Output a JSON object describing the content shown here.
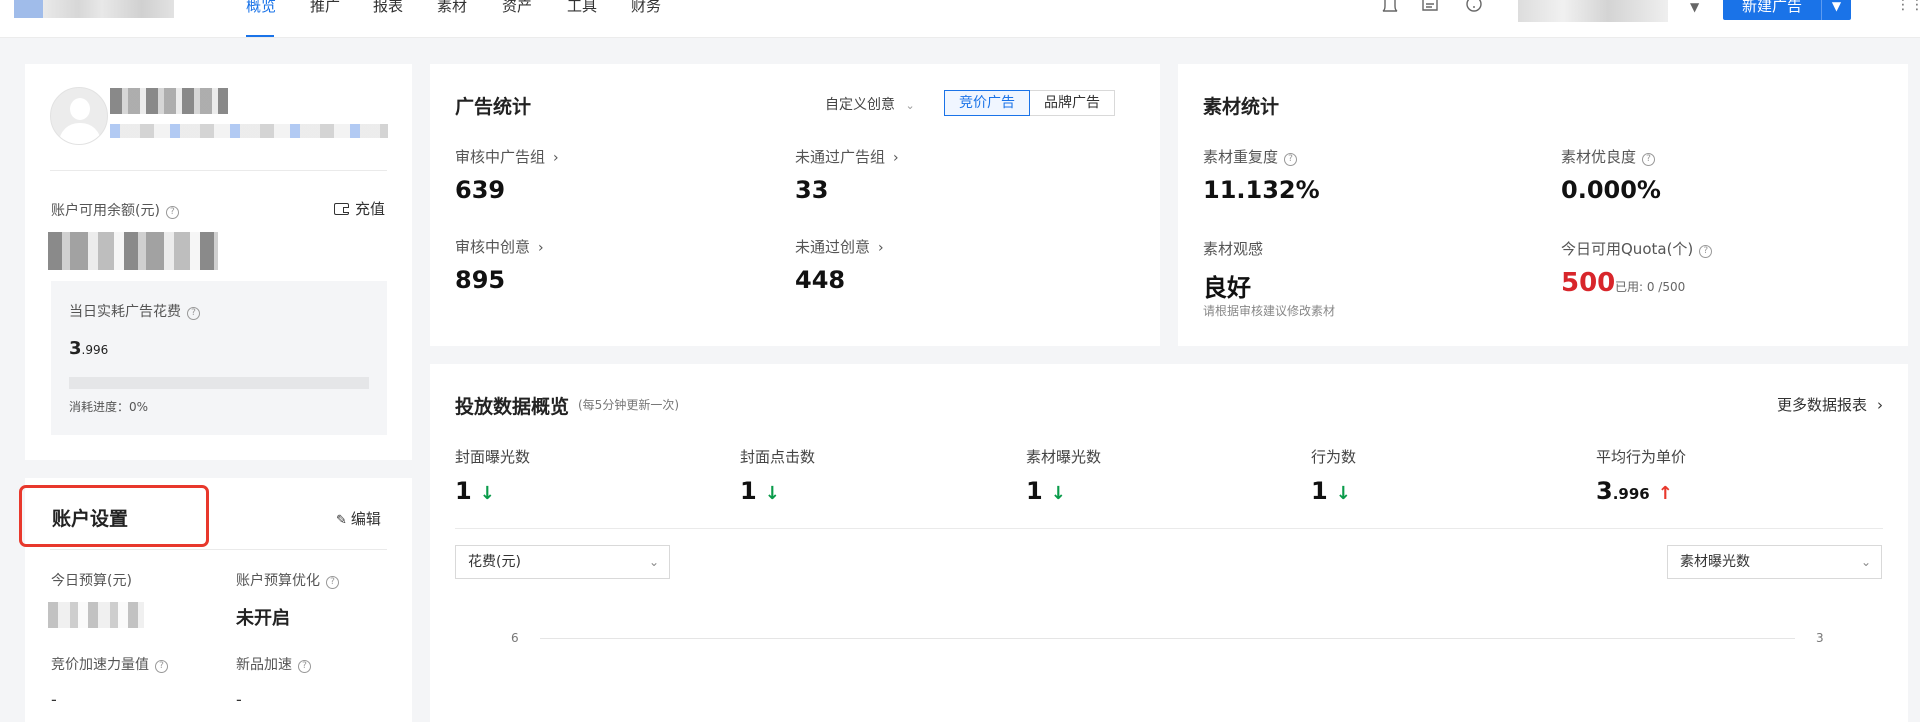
{
  "nav": {
    "items": [
      "概览",
      "推广",
      "报表",
      "素材",
      "资产",
      "工具",
      "财务"
    ],
    "active": "概览",
    "new_button": "新建广告"
  },
  "icons": [
    "bell-icon",
    "message-icon",
    "help-icon",
    "apps-grid-icon"
  ],
  "profile": {
    "balance_label": "账户可用余额(元)",
    "recharge": "充值",
    "daily_spend_label": "当日实耗广告花费",
    "daily_spend_int": "3",
    "daily_spend_dec": ".996",
    "progress_text": "消耗进度：0%",
    "progress_fraction": 0
  },
  "settings": {
    "title": "账户设置",
    "edit": "编辑",
    "today_budget_label": "今日预算(元)",
    "budget_opt_label": "账户预算优化",
    "budget_opt_value": "未开启",
    "bid_boost_label": "竞价加速力量值",
    "bid_boost_value": "-",
    "new_product_label": "新品加速",
    "new_product_value": "-"
  },
  "ad_stats": {
    "title": "广告统计",
    "dropdown": "自定义创意",
    "tabs": [
      "竞价广告",
      "品牌广告"
    ],
    "active_tab": "竞价广告",
    "items": [
      {
        "label": "审核中广告组",
        "value": "639"
      },
      {
        "label": "未通过广告组",
        "value": "33"
      },
      {
        "label": "审核中创意",
        "value": "895"
      },
      {
        "label": "未通过创意",
        "value": "448"
      }
    ]
  },
  "material_stats": {
    "title": "素材统计",
    "repeat_label": "素材重复度",
    "repeat_value": "11.132%",
    "quality_label": "素材优良度",
    "quality_value": "0.000%",
    "look_label": "素材观感",
    "look_value": "良好",
    "look_hint": "请根据审核建议修改素材",
    "quota_label": "今日可用Quota(个)",
    "quota_value": "500",
    "quota_used": "已用: 0 /500"
  },
  "overview": {
    "title": "投放数据概览",
    "subtitle": "(每5分钟更新一次)",
    "more": "更多数据报表",
    "metrics": [
      {
        "label": "封面曝光数",
        "value": "1",
        "trend": "down"
      },
      {
        "label": "封面点击数",
        "value": "1",
        "trend": "down"
      },
      {
        "label": "素材曝光数",
        "value": "1",
        "trend": "down"
      },
      {
        "label": "行为数",
        "value": "1",
        "trend": "down"
      },
      {
        "label": "平均行为单价",
        "value_int": "3",
        "value_dec": ".996",
        "trend": "up"
      }
    ],
    "left_select": "花费(元)",
    "right_select": "素材曝光数",
    "left_axis_tick": "6",
    "right_axis_tick": "3"
  }
}
